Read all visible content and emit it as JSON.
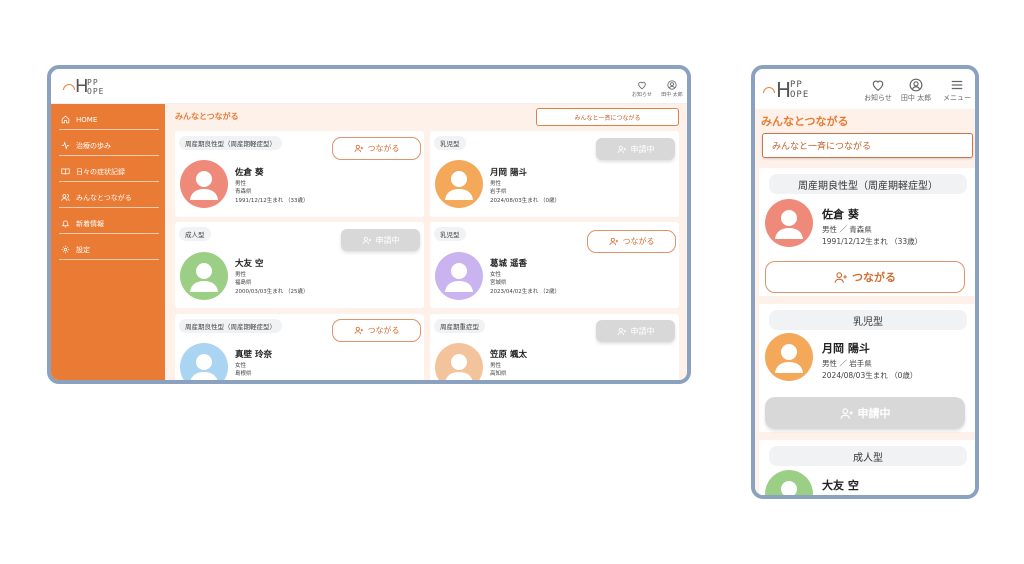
{
  "brand": {
    "logo_top": "PP",
    "logo_letter": "H",
    "logo_bottom": "OPE",
    "accent": "#e97b35",
    "frame": "#8aa2c0"
  },
  "header": {
    "notifications_label": "お知らせ",
    "user_label": "田中 太郎",
    "menu_label": "メニュー"
  },
  "sidebar": {
    "items": [
      {
        "label": "HOME",
        "icon": "home-icon"
      },
      {
        "label": "治療の歩み",
        "icon": "activity-icon"
      },
      {
        "label": "日々の症状記録",
        "icon": "book-icon"
      },
      {
        "label": "みんなとつながる",
        "icon": "users-icon"
      },
      {
        "label": "新着情報",
        "icon": "bell-icon"
      },
      {
        "label": "設定",
        "icon": "gear-icon"
      }
    ]
  },
  "main": {
    "title": "みんなとつながる",
    "bulk_connect_label": "みんなと一斉につながる",
    "connect_label": "つながる",
    "pending_label": "申請中",
    "profiles": [
      {
        "tag": "周産期良性型（周産期軽症型）",
        "name": "佐倉 葵",
        "gender": "男性",
        "prefecture": "青森県",
        "birth": "1991/12/12生まれ （33歳）",
        "status": "connect",
        "avatar_color": "#ef8a7a"
      },
      {
        "tag": "乳児型",
        "name": "月岡 陽斗",
        "gender": "男性",
        "prefecture": "岩手県",
        "birth": "2024/08/03生まれ （0歳）",
        "status": "pending",
        "avatar_color": "#f3a85a"
      },
      {
        "tag": "成人型",
        "name": "大友 空",
        "gender": "男性",
        "prefecture": "福島県",
        "birth": "2000/03/03生まれ （25歳）",
        "status": "pending",
        "avatar_color": "#9ccf86"
      },
      {
        "tag": "乳児型",
        "name": "葛城 遥香",
        "gender": "女性",
        "prefecture": "宮城県",
        "birth": "2023/04/02生まれ （2歳）",
        "status": "connect",
        "avatar_color": "#c9b4f0"
      },
      {
        "tag": "周産期良性型（周産期軽症型）",
        "name": "真壁 玲奈",
        "gender": "女性",
        "prefecture": "島根県",
        "birth": "",
        "status": "connect",
        "avatar_color": "#a9d4f2"
      },
      {
        "tag": "周産期重症型",
        "name": "笠原 颯太",
        "gender": "男性",
        "prefecture": "高知県",
        "birth": "",
        "status": "pending",
        "avatar_color": "#f3c49c"
      }
    ]
  },
  "mobile": {
    "separator": "/",
    "cards": [
      {
        "tag": "周産期良性型（周産期軽症型）",
        "name": "佐倉 葵",
        "meta": "男性 ／ 青森県",
        "birth": "1991/12/12生まれ （33歳）",
        "status": "connect",
        "avatar_color": "#ef8a7a"
      },
      {
        "tag": "乳児型",
        "name": "月岡 陽斗",
        "meta": "男性 ／ 岩手県",
        "birth": "2024/08/03生まれ （0歳）",
        "status": "pending",
        "avatar_color": "#f3a85a"
      },
      {
        "tag": "成人型",
        "name": "大友 空",
        "meta": "",
        "birth": "",
        "status": "none",
        "avatar_color": "#9ccf86"
      }
    ]
  }
}
